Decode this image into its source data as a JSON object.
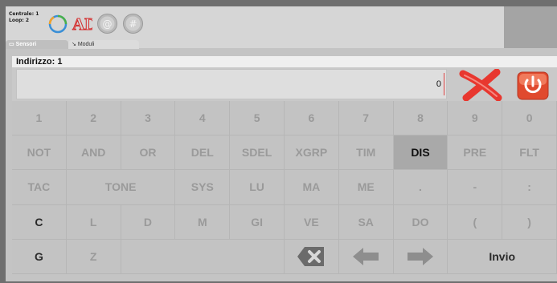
{
  "status": {
    "centrale": "Centrale: 1",
    "loop": "Loop: 2"
  },
  "top_icons": [
    "refresh-icon",
    "adv-logo",
    "at-icon",
    "hash-icon"
  ],
  "logo_text": "ADV",
  "tabs": {
    "sensori": "Sensori",
    "moduli": "Moduli"
  },
  "address_label": "Indirizzo: 1",
  "input": {
    "value": "0"
  },
  "keyboard": {
    "rows": [
      [
        "1",
        "2",
        "3",
        "4",
        "5",
        "6",
        "7",
        "8",
        "9",
        "0"
      ],
      [
        "NOT",
        "AND",
        "OR",
        "DEL",
        "SDEL",
        "XGRP",
        "TIM",
        "DIS",
        "PRE",
        "FLT"
      ],
      [
        "TAC",
        "TONE",
        "SYS",
        "LU",
        "MA",
        "ME",
        ".",
        "-",
        ":"
      ],
      [
        "C",
        "L",
        "D",
        "M",
        "GI",
        "VE",
        "SA",
        "DO",
        "(",
        ")"
      ],
      [
        "G",
        "Z",
        "Invio"
      ]
    ],
    "highlighted_key": "DIS"
  },
  "colors": {
    "background": "#c4c4c4",
    "key_text": "#9a9a9a",
    "key_text_active": "#2a2a2a",
    "clear_red": "#e8372f",
    "power_red": "#e04a2e"
  }
}
